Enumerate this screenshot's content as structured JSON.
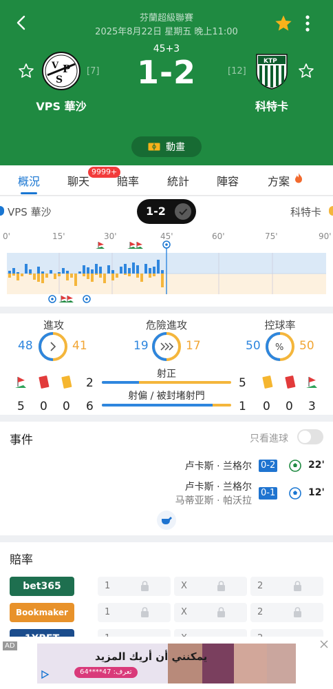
{
  "header": {
    "league": "芬蘭超級聯賽",
    "datetime": "2025年8月22日 星期五 晚上11:00",
    "minute": "45+3",
    "score": "1-2",
    "home": {
      "name": "VPS 華沙",
      "rank": "[7]"
    },
    "away": {
      "name": "科特卡",
      "rank": "[12]"
    },
    "animation_label": "動畫"
  },
  "tabs": [
    "概況",
    "聊天",
    "賠率",
    "統計",
    "陣容",
    "方案"
  ],
  "chat_badge": "9999+",
  "timeline": {
    "home": "VPS 華沙",
    "away": "科特卡",
    "score": "1-2",
    "ticks": [
      "0'",
      "15'",
      "30'",
      "45'",
      "60'",
      "75'",
      "90'"
    ]
  },
  "stats": {
    "attack": {
      "label": "進攻",
      "home": "48",
      "away": "41"
    },
    "dangerous": {
      "label": "危險進攻",
      "home": "19",
      "away": "17"
    },
    "possession": {
      "label": "控球率",
      "home": "50",
      "away": "50"
    },
    "home_counts": {
      "corners": "5",
      "red": "0",
      "yellow": "0",
      "on_target": "2",
      "off_target": "6"
    },
    "away_counts": {
      "on_target": "5",
      "off_target": "1",
      "yellow": "0",
      "red": "0",
      "corners": "3"
    },
    "shots_on_label": "射正",
    "shots_off_label": "射偏 / 被封堵射門",
    "shots_on_home_share": 0.286,
    "shots_off_home_share": 0.857
  },
  "events": {
    "title": "事件",
    "goals_only": "只看進球",
    "items": [
      {
        "player": "卢卡斯 · 兰格尔",
        "score": "0-2",
        "minute": "22'"
      },
      {
        "player": "卢卡斯 · 兰格尔",
        "assist": "马蒂亚斯 · 帕沃拉",
        "score": "0-1",
        "minute": "12'"
      }
    ]
  },
  "odds": {
    "title": "賠率",
    "bookmakers": [
      {
        "name": "bet365",
        "color": "#1e6f4f"
      },
      {
        "name": "Bookmaker",
        "color": "#e8922a"
      },
      {
        "name": "1XBET",
        "color": "#1b4c8c"
      }
    ],
    "labels": [
      "1",
      "X",
      "2"
    ]
  },
  "ad": {
    "tag": "AD",
    "text": "يمكنني أن أريك المزيد",
    "code": "تعرف: 47****64"
  },
  "colors": {
    "home": "#2e86de",
    "away": "#f4b63c",
    "header": "#1f8a41"
  }
}
